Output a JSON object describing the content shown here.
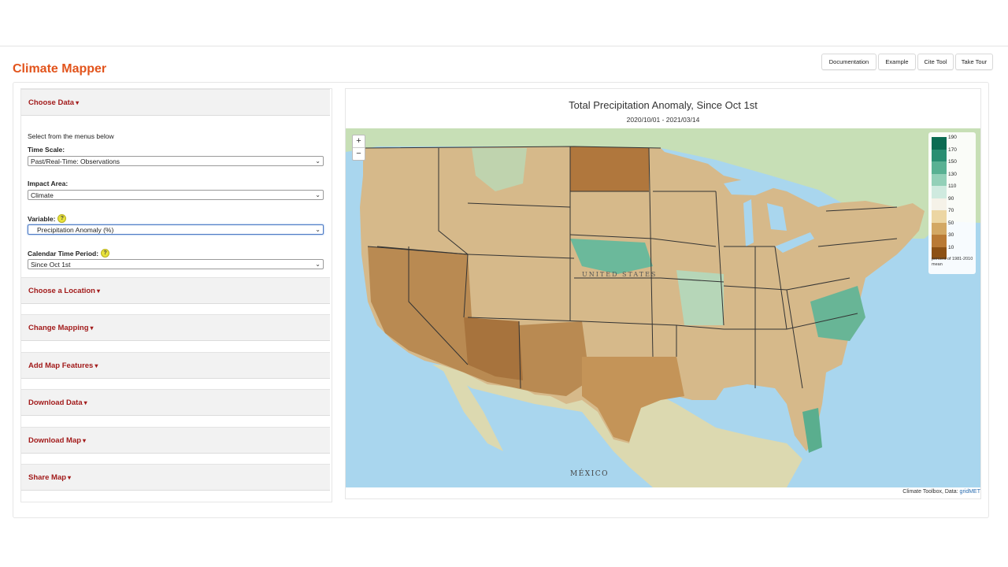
{
  "app": {
    "title": "Climate Mapper"
  },
  "top_buttons": [
    "Documentation",
    "Example",
    "Cite Tool",
    "Take Tour"
  ],
  "sidebar": {
    "sections": [
      {
        "label": "Choose Data",
        "caret": "▾"
      },
      {
        "label": "Choose a Location",
        "caret": "▾"
      },
      {
        "label": "Change Mapping",
        "caret": "▾"
      },
      {
        "label": "Add Map Features",
        "caret": "▾"
      },
      {
        "label": "Download Data",
        "caret": "▾"
      },
      {
        "label": "Download Map",
        "caret": "▾"
      },
      {
        "label": "Share Map",
        "caret": "▾"
      }
    ],
    "intro": "Select from the menus below",
    "fields": [
      {
        "label": "Time Scale:",
        "value": "Past/Real-Time: Observations"
      },
      {
        "label": "Impact Area:",
        "value": "Climate"
      },
      {
        "label": "Variable:",
        "value": "Precipitation Anomaly (%)"
      },
      {
        "label": "Calendar Time Period:",
        "value": "Since Oct 1st"
      }
    ],
    "help_glyph": "?"
  },
  "map": {
    "title": "Total Precipitation Anomaly, Since Oct 1st",
    "subtitle": "2020/10/01 - 2021/03/14",
    "zoom_in": "+",
    "zoom_out": "−",
    "basemap_labels": [
      "UNITED STATES",
      "MÉXICO"
    ],
    "credit_text": "Climate Toolbox, Data: ",
    "credit_link": "gridMET",
    "legend": {
      "ticks": [
        "190",
        "170",
        "150",
        "130",
        "110",
        "90",
        "70",
        "50",
        "30",
        "10"
      ],
      "colors": [
        "#0b6b52",
        "#2a8e72",
        "#59b193",
        "#93d0b8",
        "#cfeadf",
        "#f5f2e8",
        "#ecd6a3",
        "#d3a864",
        "#b97a35",
        "#8d5114"
      ],
      "note": "percent of 1981-2010 mean"
    },
    "colors": {
      "ocean": "#a9d6ee",
      "land_dry": "#c9a06a",
      "land_wet": "#5fb39a",
      "border": "#333333"
    }
  }
}
